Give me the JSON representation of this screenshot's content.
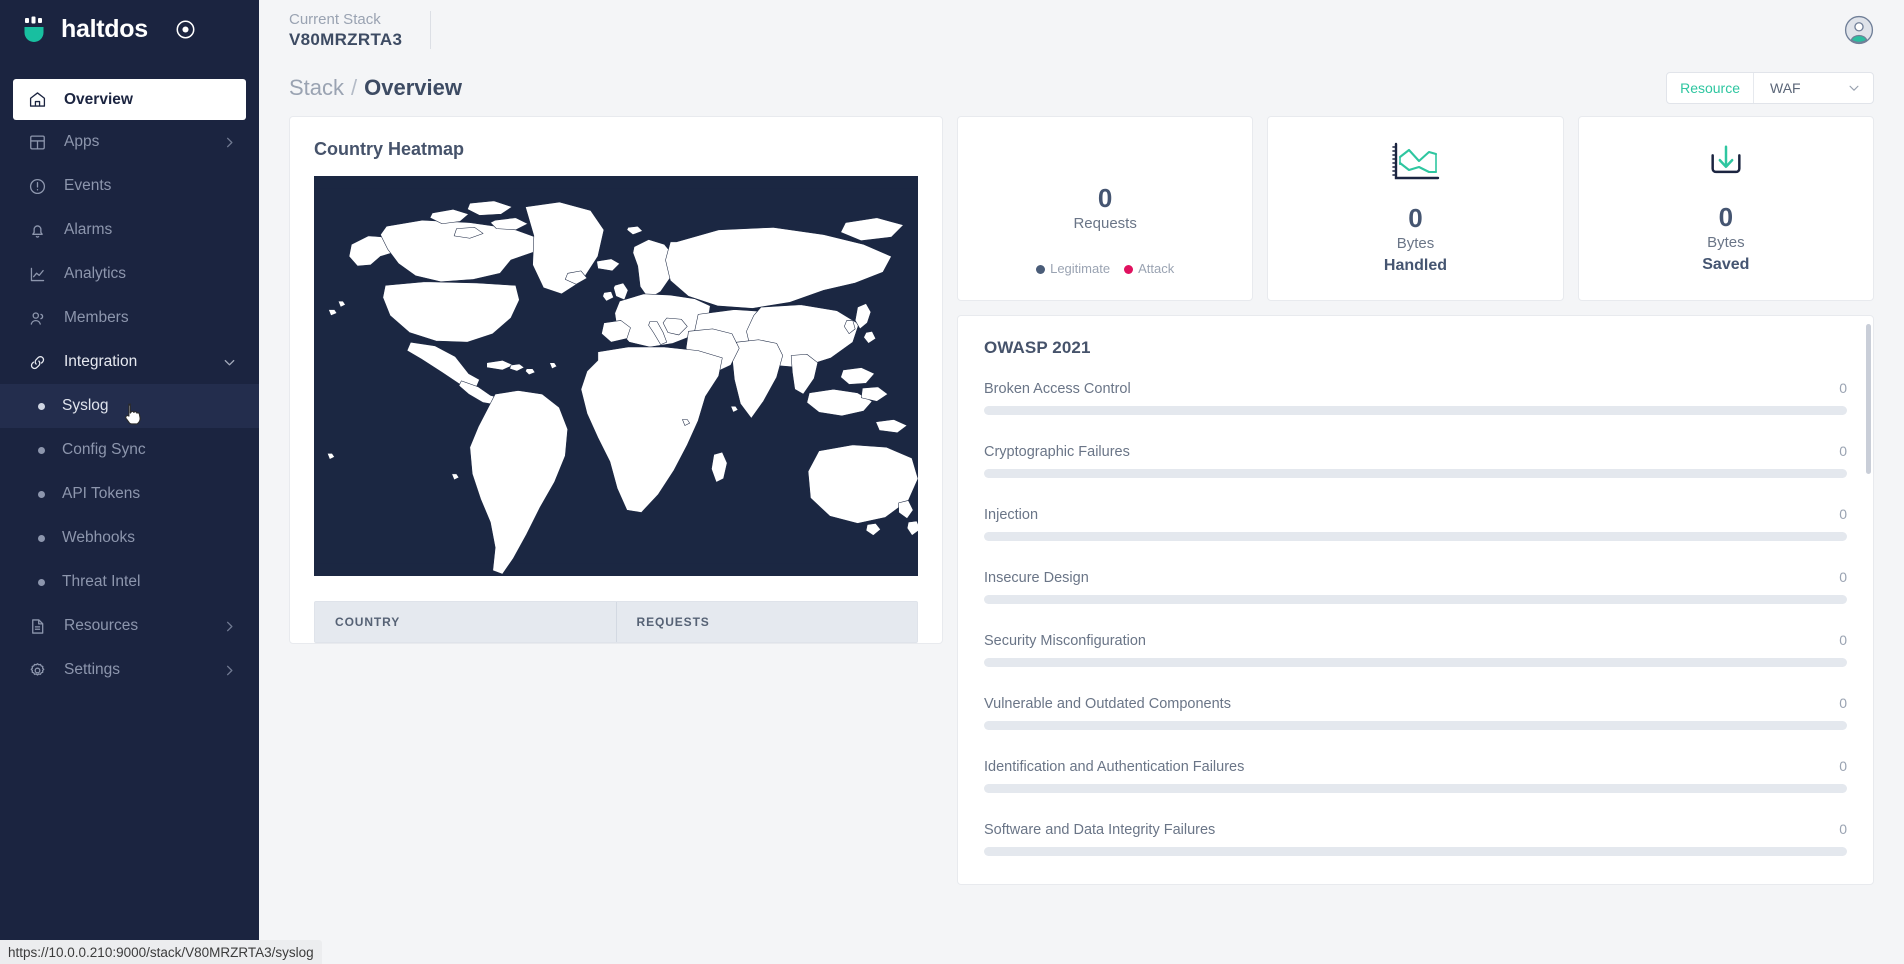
{
  "brand": {
    "name": "haltdos",
    "target_icon": "target-icon"
  },
  "sidebar": {
    "items": [
      {
        "label": "Overview",
        "icon": "home-icon",
        "state": "active"
      },
      {
        "label": "Apps",
        "icon": "grid-icon",
        "chevron": "chevron-right"
      },
      {
        "label": "Events",
        "icon": "alert-circle-icon"
      },
      {
        "label": "Alarms",
        "icon": "bell-icon"
      },
      {
        "label": "Analytics",
        "icon": "chart-line-icon"
      },
      {
        "label": "Members",
        "icon": "users-icon"
      },
      {
        "label": "Integration",
        "icon": "link-icon",
        "chevron": "chevron-down",
        "state": "expanded"
      }
    ],
    "integration_children": [
      {
        "label": "Syslog",
        "state": "selected"
      },
      {
        "label": "Config Sync"
      },
      {
        "label": "API Tokens"
      },
      {
        "label": "Webhooks"
      },
      {
        "label": "Threat Intel"
      }
    ],
    "items_bottom": [
      {
        "label": "Resources",
        "icon": "document-icon",
        "chevron": "chevron-right"
      },
      {
        "label": "Settings",
        "icon": "gear-icon",
        "chevron": "chevron-right"
      }
    ]
  },
  "topbar": {
    "stack_label": "Current Stack",
    "stack_value": "V80MRZRTA3",
    "avatar": "user-avatar-icon"
  },
  "breadcrumb": {
    "root": "Stack",
    "sep": "/",
    "current": "Overview"
  },
  "resource_picker": {
    "label": "Resource",
    "value": "WAF",
    "caret": "chevron-down-icon"
  },
  "heatmap": {
    "title": "Country Heatmap",
    "table_headers": [
      "COUNTRY",
      "REQUESTS"
    ],
    "rows": [],
    "map_bg": "#1b2742",
    "land_fill": "#ffffff"
  },
  "stats": [
    {
      "value": "0",
      "label": "Requests",
      "legend": [
        {
          "text": "Legitimate",
          "color": "#4a5c78"
        },
        {
          "text": "Attack",
          "color": "#e0115f"
        }
      ]
    },
    {
      "icon": "area-chart-icon",
      "value": "0",
      "line1": "Bytes",
      "line2": "Handled"
    },
    {
      "icon": "download-tray-icon",
      "value": "0",
      "line1": "Bytes",
      "line2": "Saved"
    }
  ],
  "owasp": {
    "title": "OWASP 2021",
    "chart_data": {
      "type": "bar",
      "title": "OWASP 2021",
      "categories": [
        "Broken Access Control",
        "Cryptographic Failures",
        "Injection",
        "Insecure Design",
        "Security Misconfiguration",
        "Vulnerable and Outdated Components",
        "Identification and Authentication Failures",
        "Software and Data Integrity Failures"
      ],
      "values": [
        0,
        0,
        0,
        0,
        0,
        0,
        0,
        0
      ],
      "xlabel": "",
      "ylabel": "",
      "ylim": [
        0,
        100
      ],
      "orientation": "horizontal"
    },
    "rows": [
      {
        "name": "Broken Access Control",
        "value": "0",
        "pct": 0
      },
      {
        "name": "Cryptographic Failures",
        "value": "0",
        "pct": 0
      },
      {
        "name": "Injection",
        "value": "0",
        "pct": 0
      },
      {
        "name": "Insecure Design",
        "value": "0",
        "pct": 0
      },
      {
        "name": "Security Misconfiguration",
        "value": "0",
        "pct": 0
      },
      {
        "name": "Vulnerable and Outdated Components",
        "value": "0",
        "pct": 0
      },
      {
        "name": "Identification and Authentication Failures",
        "value": "0",
        "pct": 0
      },
      {
        "name": "Software and Data Integrity Failures",
        "value": "0",
        "pct": 0
      }
    ]
  },
  "statusbar": {
    "url": "https://10.0.0.210:9000/stack/V80MRZRTA3/syslog"
  },
  "colors": {
    "sidebar_bg": "#1b2440",
    "accent_teal": "#2ec6a0",
    "text_dark": "#3d4b63",
    "page_bg": "#f4f5f7"
  }
}
